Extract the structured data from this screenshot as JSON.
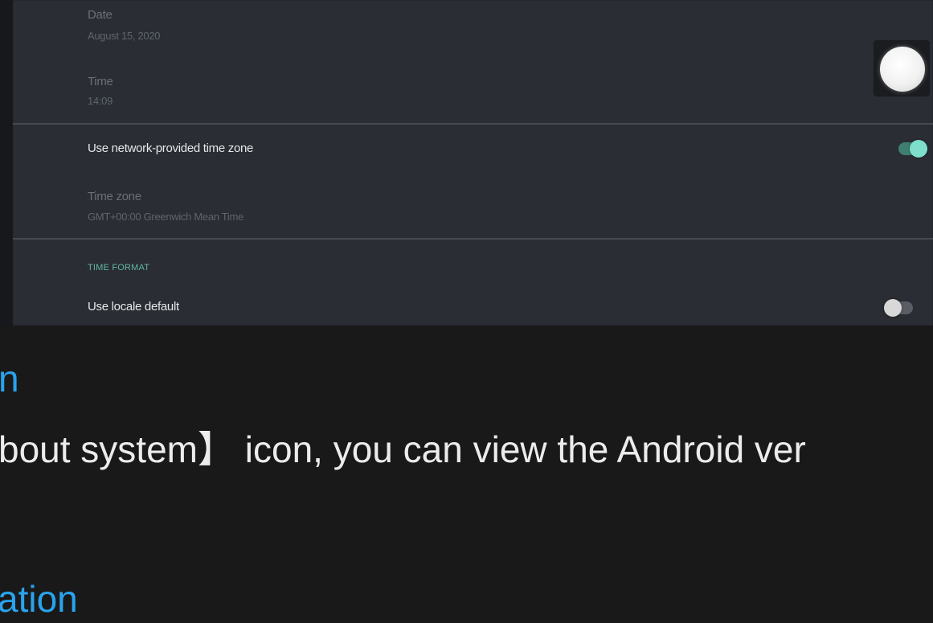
{
  "settings_screenshot": {
    "date": {
      "title": "Date",
      "value": "August 15, 2020"
    },
    "time": {
      "title": "Time",
      "value": "14:09"
    },
    "network_time_zone": {
      "label": "Use network-provided time zone",
      "enabled": true
    },
    "time_zone": {
      "title": "Time zone",
      "value": "GMT+00:00 Greenwich Mean Time"
    },
    "time_format_header": "TIME FORMAT",
    "locale_default": {
      "label": "Use locale default",
      "enabled": false
    },
    "colors": {
      "accent": "#5fb7a5",
      "panel": "#2a2d33"
    },
    "icons": {
      "clock": "analog-clock-icon"
    }
  },
  "document": {
    "heading_partial": "n",
    "body_partial": "bout system】 icon, you can view the Android ver",
    "next_heading_partial": "ation",
    "colors": {
      "heading": "#2aa3ee",
      "text": "#ececec",
      "background": "#191919"
    }
  }
}
